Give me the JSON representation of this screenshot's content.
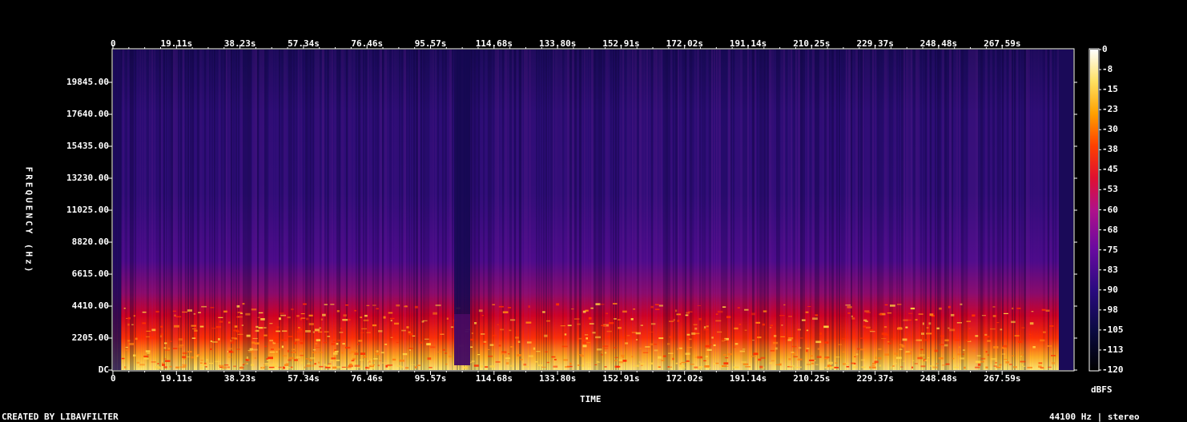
{
  "chart_data": {
    "type": "heatmap",
    "xlabel": "TIME",
    "ylabel": "FREQUENCY (Hz)",
    "x_ticks": [
      "0",
      "19.11s",
      "38.23s",
      "57.34s",
      "76.46s",
      "95.57s",
      "114.68s",
      "133.80s",
      "152.91s",
      "172.02s",
      "191.14s",
      "210.25s",
      "229.37s",
      "248.48s",
      "267.59s"
    ],
    "y_ticks": [
      "DC",
      "2205.00",
      "4410.00",
      "6615.00",
      "8820.00",
      "11025.00",
      "13230.00",
      "15435.00",
      "17640.00",
      "19845.00"
    ],
    "colorbar_label": "dBFS",
    "colorbar_ticks": [
      "0",
      "-8",
      "-15",
      "-23",
      "-30",
      "-38",
      "-45",
      "-53",
      "-60",
      "-68",
      "-75",
      "-83",
      "-90",
      "-98",
      "-105",
      "-113",
      "-120"
    ],
    "xlim_s": [
      0,
      286.7
    ],
    "ylim_hz": [
      0,
      22050
    ],
    "zlim_dbfs": [
      -120,
      0
    ],
    "colormap": "magma-like (black → blue → purple → red → orange → yellow → white)",
    "footer_left": "CREATED BY LIBAVFILTER",
    "footer_right": "44100 Hz | stereo"
  }
}
